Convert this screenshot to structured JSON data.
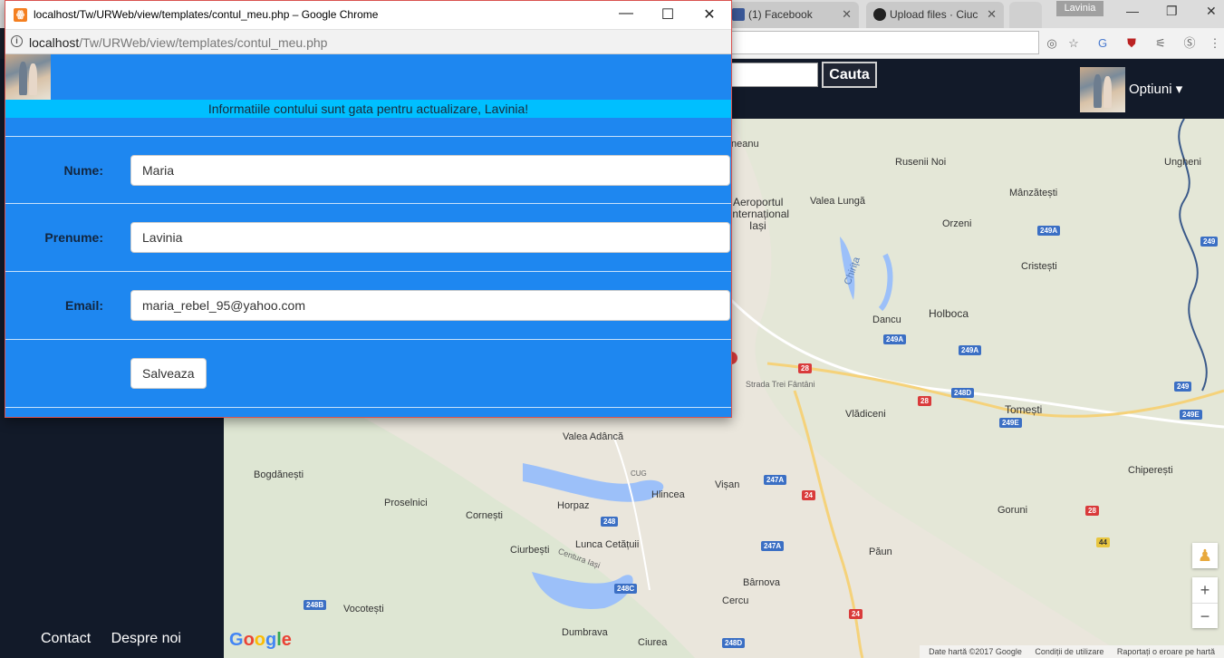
{
  "popup": {
    "title": "localhost/Tw/URWeb/view/templates/contul_meu.php – Google Chrome",
    "url_host": "localhost",
    "url_path": "/Tw/URWeb/view/templates/contul_meu.php",
    "notice": "Informatiile contului sunt gata pentru actualizare, Lavinia!",
    "form": {
      "nume_label": "Nume:",
      "nume_value": "Maria",
      "prenume_label": "Prenume:",
      "prenume_value": "Lavinia",
      "email_label": "Email:",
      "email_value": "maria_rebel_95@yahoo.com",
      "save_label": "Salveaza"
    }
  },
  "browser": {
    "tabs": [
      {
        "label": "(1) Facebook"
      },
      {
        "label": "Upload files · Ciuc"
      }
    ],
    "profile_name": "Lavinia"
  },
  "site": {
    "search_button": "Cauta",
    "options_label": "Optiuni ▾",
    "footer_links": [
      "Contact",
      "Despre noi"
    ]
  },
  "map": {
    "places": [
      "neanu",
      "Rusenii Noi",
      "Ungheni",
      "Mânzătești",
      "Aeroportul",
      "Internațional",
      "Iași",
      "Valea Lungă",
      "Orzeni",
      "Cristești",
      "Chirița",
      "Dancu",
      "Holboca",
      "Strada Trei Fântâni",
      "Vlădiceni",
      "Tomești",
      "Valea Adâncă",
      "Bogdănești",
      "Proselnici",
      "Cornești",
      "Horpaz",
      "Hlincea",
      "Vișan",
      "Chiperești",
      "Goruni",
      "Ciurbești",
      "Lunca Cetățuii",
      "Centura Iași",
      "Păun",
      "Bârnova",
      "Cercu",
      "Vocotești",
      "Dumbrava",
      "Ciurea",
      "CUG"
    ],
    "roads": [
      "249A",
      "249",
      "249A",
      "249A",
      "28",
      "248D",
      "28",
      "249E",
      "249",
      "249E",
      "247A",
      "24",
      "248",
      "247A",
      "28",
      "44",
      "248C",
      "248B",
      "24",
      "248D"
    ],
    "footer": [
      "Date hartă ©2017 Google",
      "Condiții de utilizare",
      "Raportați o eroare pe hartă"
    ],
    "zoom_in": "+",
    "zoom_out": "−"
  }
}
